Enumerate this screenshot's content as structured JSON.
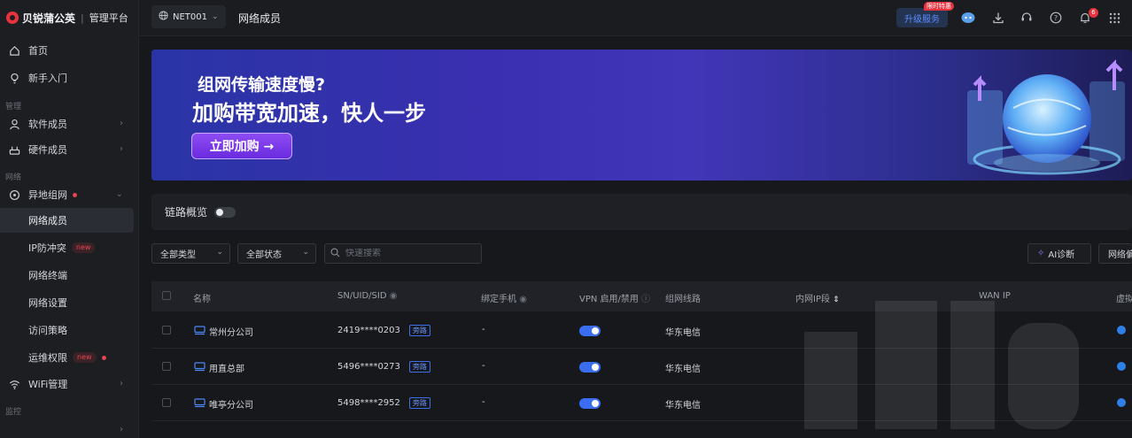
{
  "brand": {
    "name": "贝锐蒲公英",
    "subtitle": "管理平台",
    "color": "#e6333e"
  },
  "sidebar": {
    "items_top": [
      {
        "label": "首页",
        "icon": "home-icon"
      },
      {
        "label": "新手入门",
        "icon": "lightbulb-icon"
      }
    ],
    "section_manage": "管理",
    "items_manage": [
      {
        "label": "软件成员",
        "icon": "user-icon"
      },
      {
        "label": "硬件成员",
        "icon": "router-icon"
      }
    ],
    "section_network": "网络",
    "network_group": {
      "label": "异地组网",
      "icon": "network-icon"
    },
    "network_items": [
      {
        "label": "网络成员",
        "active": true
      },
      {
        "label": "IP防冲突",
        "badge": "new"
      },
      {
        "label": "网络终端"
      },
      {
        "label": "网络设置"
      },
      {
        "label": "访问策略"
      },
      {
        "label": "运维权限",
        "badge": "new"
      }
    ],
    "wifi_item": {
      "label": "WiFi管理",
      "icon": "wifi-icon"
    },
    "section_monitor": "监控"
  },
  "topbar": {
    "network": "NET001",
    "title": "网络成员",
    "upgrade_label": "升级服务",
    "promo_tag": "限时特惠",
    "notification_count": "6",
    "accent": "#3a6df0"
  },
  "banner": {
    "line1": "组网传输速度慢?",
    "line2": "加购带宽加速，快人一步",
    "button": "立即加购 →"
  },
  "overview": {
    "label": "链路概览",
    "enabled": false
  },
  "filters": {
    "type_select": "全部类型",
    "status_select": "全部状态",
    "search_placeholder": "快速搜索",
    "ai_button": "AI诊断",
    "right_button": "网络偏"
  },
  "table": {
    "columns": [
      "名称",
      "SN/UID/SID",
      "绑定手机",
      "VPN 启用/禁用",
      "组网线路",
      "内网IP段",
      "WAN IP",
      "虚拟"
    ],
    "rows": [
      {
        "name": "常州分公司",
        "sn": "2419****0203",
        "tag": "旁路",
        "phone": "-",
        "vpn": true,
        "line": "华东电信"
      },
      {
        "name": "用直总部",
        "sn": "5496****0273",
        "tag": "旁路",
        "phone": "-",
        "vpn": true,
        "line": "华东电信"
      },
      {
        "name": "唯亭分公司",
        "sn": "5498****2952",
        "tag": "旁路",
        "phone": "-",
        "vpn": true,
        "line": "华东电信"
      }
    ]
  }
}
